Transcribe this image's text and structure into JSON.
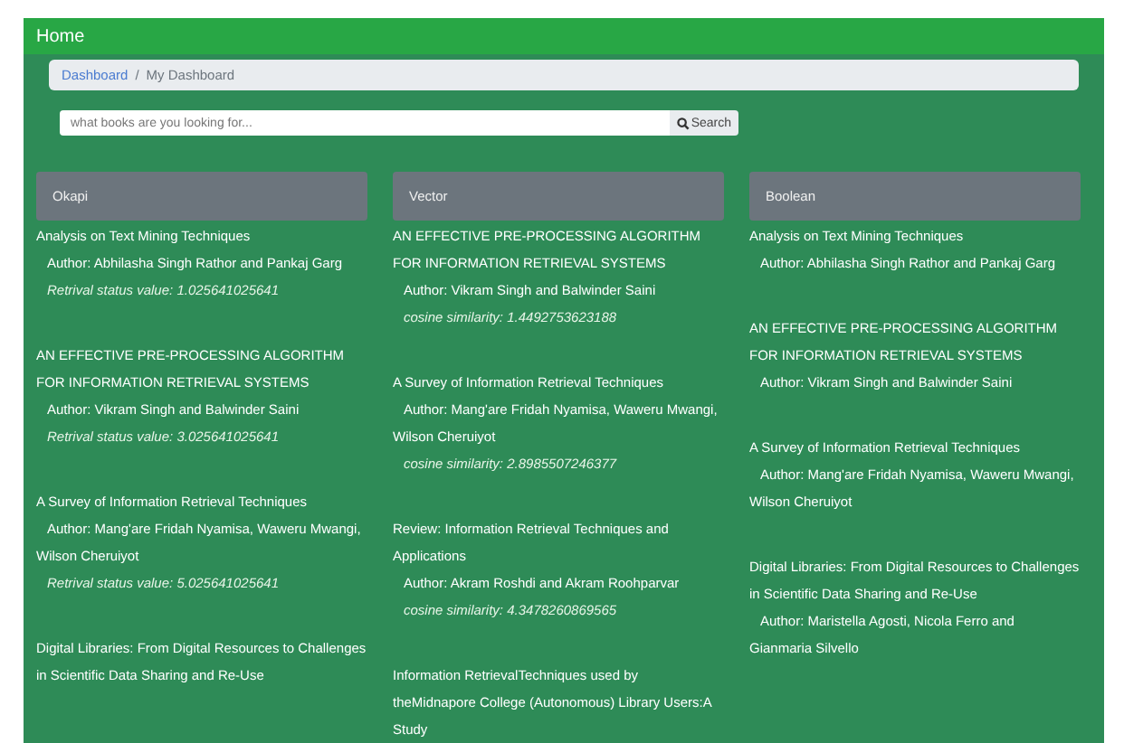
{
  "navbar": {
    "title": "Home"
  },
  "breadcrumb": [
    {
      "label": "Dashboard",
      "kind": "link"
    },
    {
      "label": "My Dashboard",
      "kind": "current"
    }
  ],
  "breadcrumb_separator": "/",
  "search": {
    "placeholder": "what books are you looking for...",
    "button": "Search"
  },
  "columns": [
    {
      "title": "Okapi",
      "results": [
        {
          "title": "Analysis on Text Mining Techniques",
          "author": "Author: Abhilasha Singh Rathor and Pankaj Garg",
          "score": "Retrival status value: 1.025641025641"
        },
        {
          "title": "AN EFFECTIVE PRE-PROCESSING ALGORITHM FOR INFORMATION RETRIEVAL SYSTEMS",
          "author": "Author: Vikram Singh and Balwinder Saini",
          "score": "Retrival status value: 3.025641025641"
        },
        {
          "title": "A Survey of Information Retrieval Techniques",
          "author": "Author: Mang'are Fridah Nyamisa, Waweru Mwangi, Wilson Cheruiyot",
          "score": "Retrival status value: 5.025641025641"
        },
        {
          "title": "Digital Libraries: From Digital Resources to Challenges in Scientific Data Sharing and Re-Use"
        }
      ]
    },
    {
      "title": "Vector",
      "results": [
        {
          "title": "AN EFFECTIVE PRE-PROCESSING ALGORITHM FOR INFORMATION RETRIEVAL SYSTEMS",
          "author": "Author: Vikram Singh and Balwinder Saini",
          "score": "cosine similarity: 1.4492753623188"
        },
        {
          "title": "A Survey of Information Retrieval Techniques",
          "author": "Author: Mang'are Fridah Nyamisa, Waweru Mwangi, Wilson Cheruiyot",
          "score": "cosine similarity: 2.8985507246377"
        },
        {
          "title": "Review: Information Retrieval Techniques and Applications",
          "author": "Author: Akram Roshdi and Akram Roohparvar",
          "score": "cosine similarity: 4.3478260869565"
        },
        {
          "title": "Information RetrievalTechniques used by theMidnapore College (Autonomous) Library Users:A Study"
        }
      ]
    },
    {
      "title": "Boolean",
      "results": [
        {
          "title": "Analysis on Text Mining Techniques",
          "author": "Author: Abhilasha Singh Rathor and Pankaj Garg"
        },
        {
          "title": "AN EFFECTIVE PRE-PROCESSING ALGORITHM FOR INFORMATION RETRIEVAL SYSTEMS",
          "author": "Author: Vikram Singh and Balwinder Saini"
        },
        {
          "title": "A Survey of Information Retrieval Techniques",
          "author": "Author: Mang'are Fridah Nyamisa, Waweru Mwangi, Wilson Cheruiyot"
        },
        {
          "title": "Digital Libraries: From Digital Resources to Challenges in Scientific Data Sharing and Re-Use",
          "author": "Author: Maristella Agosti, Nicola Ferro and Gianmaria Silvello"
        }
      ]
    }
  ]
}
